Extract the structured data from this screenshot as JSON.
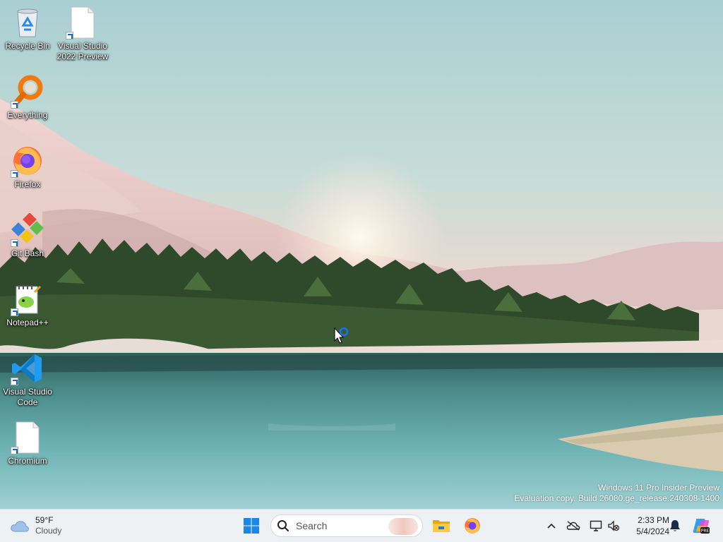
{
  "desktop": {
    "icons": [
      {
        "name": "recycle-bin",
        "label": "Recycle Bin"
      },
      {
        "name": "visual-studio-2022-preview",
        "label": "Visual Studio 2022 Preview"
      },
      {
        "name": "everything",
        "label": "Everything"
      },
      {
        "name": "firefox",
        "label": "Firefox"
      },
      {
        "name": "git-bash",
        "label": "Git Bash"
      },
      {
        "name": "notepad-plus-plus",
        "label": "Notepad++"
      },
      {
        "name": "visual-studio-code",
        "label": "Visual Studio Code"
      },
      {
        "name": "chromium",
        "label": "Chromium"
      }
    ],
    "watermark": {
      "line1": "Windows 11 Pro Insider Preview",
      "line2": "Evaluation copy. Build 26080.ge_release.240308-1400"
    }
  },
  "taskbar": {
    "weather": {
      "temperature": "59°F",
      "condition": "Cloudy",
      "icon": "cloud-icon"
    },
    "start_icon": "windows-logo-icon",
    "search": {
      "placeholder": "Search"
    },
    "pinned": [
      {
        "name": "file-explorer",
        "icon": "folder-icon"
      },
      {
        "name": "firefox",
        "icon": "firefox-icon"
      }
    ],
    "tray": {
      "icons": [
        "chevron-up-icon",
        "onedrive-icon",
        "network-icon",
        "volume-muted-icon",
        "bell-icon",
        "copilot-icon"
      ],
      "time": "2:33 PM",
      "date": "5/4/2024"
    }
  },
  "colors": {
    "taskbar_bg": "#eef1f4",
    "accent": "#0078d4"
  }
}
